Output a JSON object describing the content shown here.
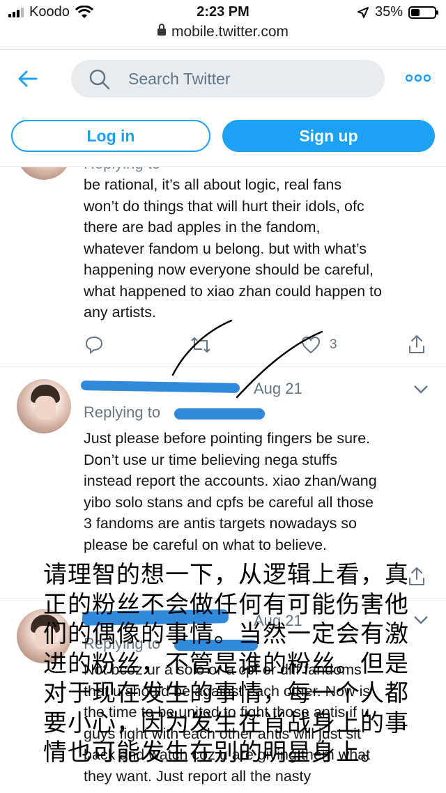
{
  "status_bar": {
    "carrier": "Koodo",
    "time": "2:23 PM",
    "battery": "35%",
    "battery_level": 0.35
  },
  "browser": {
    "url": "mobile.twitter.com"
  },
  "header": {
    "search_placeholder": "Search Twitter",
    "login_label": "Log in",
    "signup_label": "Sign up",
    "brand_color": "#1da1f2"
  },
  "tweets": [
    {
      "replying_partial": "Replying to",
      "text_lines": [
        "be rational, it’s all about logic, real fans",
        "won’t do things that will hurt their idols, ofc",
        "there are bad apples in the fandom,",
        "whatever fandom u belong. but with what’s",
        "happening now everyone should be careful,",
        "what happened to xiao zhan could happen to",
        "any artists."
      ],
      "like_count": "3"
    },
    {
      "date": "Aug 21",
      "replying_label": "Replying to",
      "text_lines": [
        "Just please before pointing fingers be sure.",
        "Don’t use ur time believing nega stuffs",
        "instead report the accounts. xiao zhan/wang",
        "yibo solo stans and cpfs be careful all those",
        "3 fandoms are antis targets nowadays so",
        "please be careful on what to believe."
      ]
    },
    {
      "date": "Aug 21",
      "replying_label": "Replying to",
      "text_lines": [
        "Not bcoz ur a solo or a cpf or diff fandoms",
        "that u should be against each other. Now is",
        "the time to be united to fight those antis if u",
        "guys fight with each other antis will just sit",
        "back and watch coz u are giving them what",
        "they want. Just report all the nasty"
      ]
    }
  ],
  "overlay_caption": {
    "lines": [
      "请理智的想一下，从逻辑上看，真",
      "正的粉丝不会做任何有可能伤害他",
      "们的偶像的事情。当然一定会有激",
      "进的粉丝，不管是谁的粉丝。但是",
      "对于现在发生的事情，每一个人都",
      "要小心，因为发生在肖战身上的事",
      "情也可能发生在别的明星身上。"
    ]
  }
}
